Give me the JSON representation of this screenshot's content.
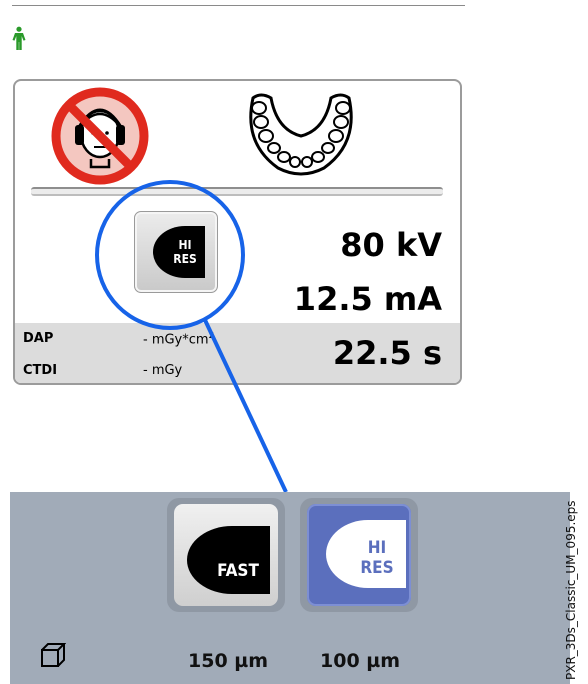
{
  "panel": {
    "kv": "80 kV",
    "ma": "12.5 mA",
    "time": "22.5 s",
    "dap_label": "DAP",
    "dap_value": "- mGy*cm",
    "dap_unit_exp": "2",
    "ctdi_label": "CTDI",
    "ctdi_value": "- mGy",
    "hires_btn_text_1": "HI",
    "hires_btn_text_2": "RES"
  },
  "modes": {
    "fast_label": "FAST",
    "hires_label_1": "HI",
    "hires_label_2": "RES",
    "fast_resolution": "150 µm",
    "hires_resolution": "100 µm"
  },
  "caption": "PXR_3Ds_Classic_UM_095.eps",
  "colors": {
    "highlight_blue": "#1763e8",
    "selected_mode": "#5b6fbd",
    "bottom_bar": "#a1abb8",
    "person_icon": "#2a9a2a"
  }
}
